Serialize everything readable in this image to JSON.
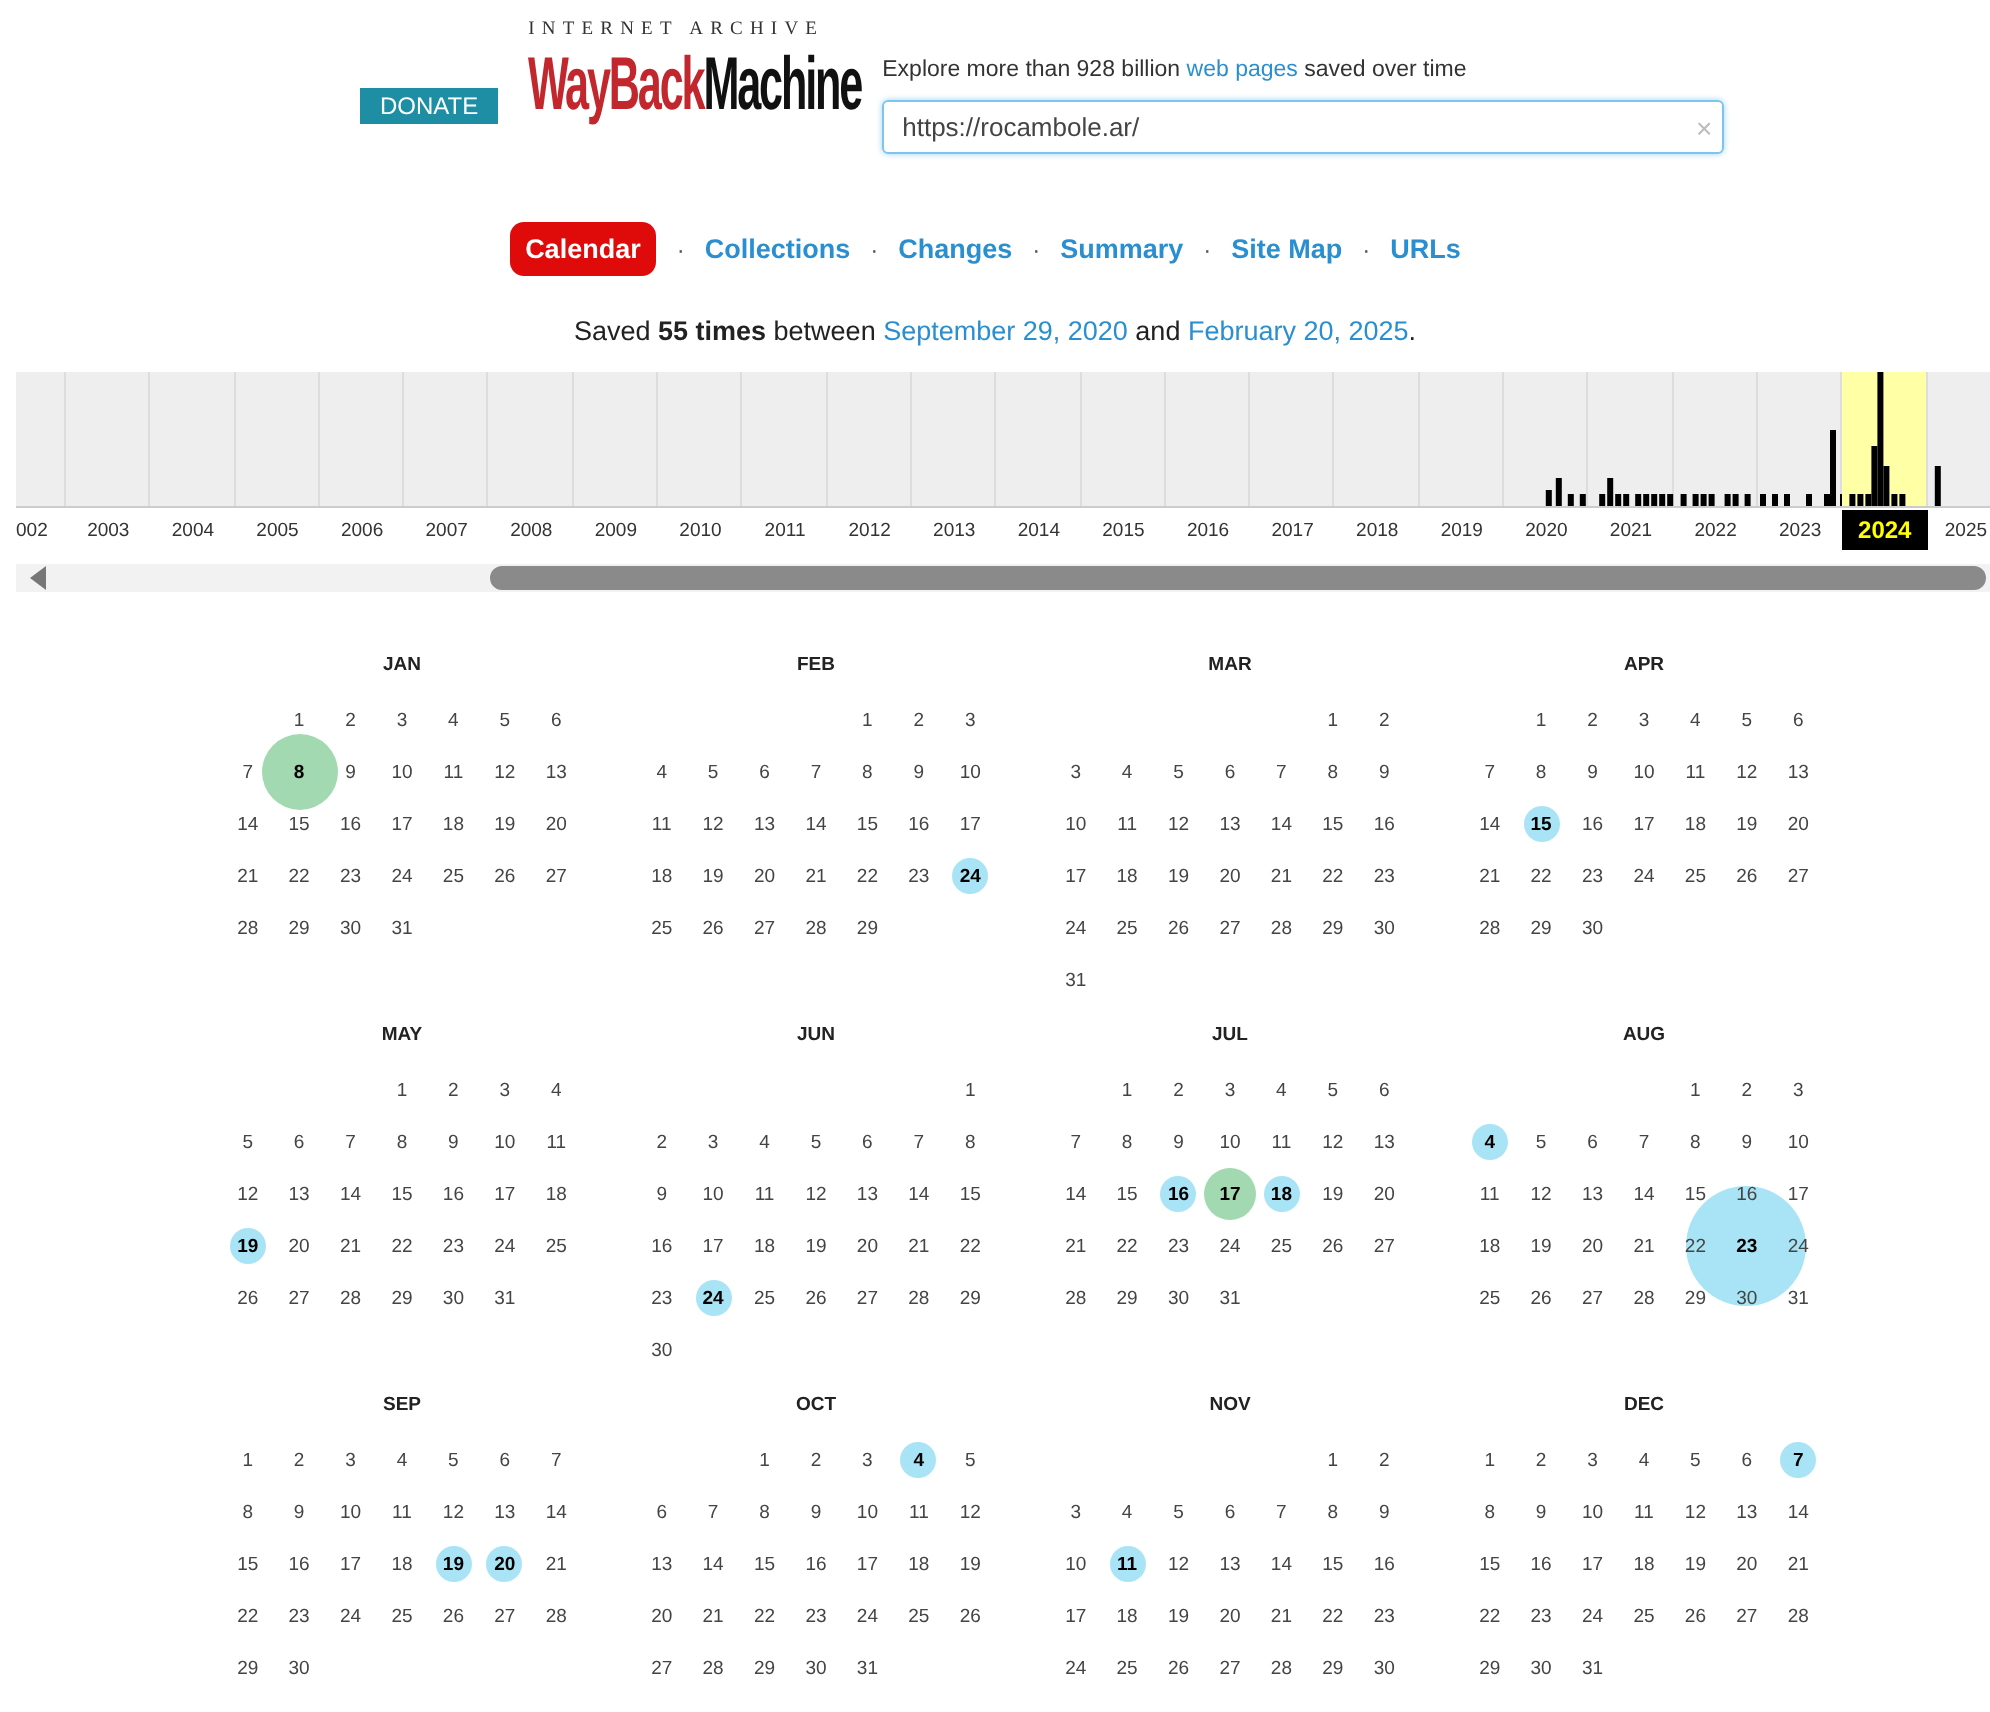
{
  "header": {
    "donate": "DONATE",
    "logo": {
      "top": "INTERNET ARCHIVE",
      "word_red": "WayBack",
      "word_black": "Machine"
    },
    "tagline": {
      "before": "Explore more than 928 billion ",
      "link": "web pages",
      "after": " saved over time"
    },
    "search": {
      "value": "https://rocambole.ar/",
      "clear": "×"
    }
  },
  "tabs": [
    {
      "label": "Calendar",
      "selected": true
    },
    {
      "label": "Collections",
      "selected": false
    },
    {
      "label": "Changes",
      "selected": false
    },
    {
      "label": "Summary",
      "selected": false
    },
    {
      "label": "Site Map",
      "selected": false
    },
    {
      "label": "URLs",
      "selected": false
    }
  ],
  "separator": "·",
  "summary": {
    "before": "Saved **55 times** between ",
    "first": "September 29, 2020",
    "middle": " and ",
    "last": "February 20, 2025",
    "after": "."
  },
  "timeline": {
    "years": [
      {
        "label": "002",
        "selected": false
      },
      {
        "label": "2003",
        "selected": false
      },
      {
        "label": "2004",
        "selected": false
      },
      {
        "label": "2005",
        "selected": false
      },
      {
        "label": "2006",
        "selected": false
      },
      {
        "label": "2007",
        "selected": false
      },
      {
        "label": "2008",
        "selected": false
      },
      {
        "label": "2009",
        "selected": false
      },
      {
        "label": "2010",
        "selected": false
      },
      {
        "label": "2011",
        "selected": false
      },
      {
        "label": "2012",
        "selected": false
      },
      {
        "label": "2013",
        "selected": false
      },
      {
        "label": "2014",
        "selected": false
      },
      {
        "label": "2015",
        "selected": false
      },
      {
        "label": "2016",
        "selected": false
      },
      {
        "label": "2017",
        "selected": false
      },
      {
        "label": "2018",
        "selected": false
      },
      {
        "label": "2019",
        "selected": false
      },
      {
        "label": "2020",
        "selected": false
      },
      {
        "label": "2021",
        "selected": false
      },
      {
        "label": "2022",
        "selected": false
      },
      {
        "label": "2023",
        "selected": false
      },
      {
        "label": "2024",
        "selected": true
      },
      {
        "label": "2025",
        "selected": false
      }
    ]
  },
  "calendar": {
    "months": [
      {
        "name": "JAN",
        "weeks": [
          [
            "1",
            "2",
            "3",
            "4",
            "5",
            "6"
          ],
          [
            "7",
            {
              "day": "8",
              "color": "#a3d9b1",
              "kind": "large"
            },
            "9",
            "10",
            "11",
            "12",
            "13"
          ],
          [
            "14",
            "15",
            "16",
            "17",
            "18",
            "19",
            "20"
          ],
          [
            "21",
            "22",
            "23",
            "24",
            "25",
            "26",
            "27"
          ],
          [
            "28",
            "29",
            "30",
            "31"
          ]
        ]
      },
      {
        "name": "FEB",
        "weeks": [
          [
            "1",
            "2",
            "3"
          ],
          [
            "4",
            "5",
            "6",
            "7",
            "8",
            "9",
            "10"
          ],
          [
            "11",
            "12",
            "13",
            "14",
            "15",
            "16",
            "17"
          ],
          [
            "18",
            "19",
            "20",
            "21",
            "22",
            "23",
            {
              "day": "24",
              "color": "#a8e4f6",
              "kind": "small"
            }
          ],
          [
            "25",
            "26",
            "27",
            "28",
            "29"
          ]
        ]
      },
      {
        "name": "MAR",
        "weeks": [
          [
            "1",
            "2"
          ],
          [
            "3",
            "4",
            "5",
            "6",
            "7",
            "8",
            "9"
          ],
          [
            "10",
            "11",
            "12",
            "13",
            "14",
            "15",
            "16"
          ],
          [
            "17",
            "18",
            "19",
            "20",
            "21",
            "22",
            "23"
          ],
          [
            "24",
            "25",
            "26",
            "27",
            "28",
            "29",
            "30"
          ],
          [
            "31"
          ]
        ]
      },
      {
        "name": "APR",
        "weeks": [
          [
            "1",
            "2",
            "3",
            "4",
            "5",
            "6"
          ],
          [
            "7",
            "8",
            "9",
            "10",
            "11",
            "12",
            "13"
          ],
          [
            "14",
            {
              "day": "15",
              "color": "#a8e4f6",
              "kind": "small"
            },
            "16",
            "17",
            "18",
            "19",
            "20"
          ],
          [
            "21",
            "22",
            "23",
            "24",
            "25",
            "26",
            "27"
          ],
          [
            "28",
            "29",
            "30"
          ]
        ]
      },
      {
        "name": "MAY",
        "weeks": [
          [
            "1",
            "2",
            "3",
            "4"
          ],
          [
            "5",
            "6",
            "7",
            "8",
            "9",
            "10",
            "11"
          ],
          [
            "12",
            "13",
            "14",
            "15",
            "16",
            "17",
            "18"
          ],
          [
            {
              "day": "19",
              "color": "#a8e4f6",
              "kind": "small"
            },
            "20",
            "21",
            "22",
            "23",
            "24",
            "25"
          ],
          [
            "26",
            "27",
            "28",
            "29",
            "30",
            "31"
          ]
        ]
      },
      {
        "name": "JUN",
        "weeks": [
          [
            "1"
          ],
          [
            "2",
            "3",
            "4",
            "5",
            "6",
            "7",
            "8"
          ],
          [
            "9",
            "10",
            "11",
            "12",
            "13",
            "14",
            "15"
          ],
          [
            "16",
            "17",
            "18",
            "19",
            "20",
            "21",
            "22"
          ],
          [
            "23",
            {
              "day": "24",
              "color": "#a8e4f6",
              "kind": "small"
            },
            "25",
            "26",
            "27",
            "28",
            "29"
          ],
          [
            "30"
          ]
        ]
      },
      {
        "name": "JUL",
        "weeks": [
          [
            "1",
            "2",
            "3",
            "4",
            "5",
            "6"
          ],
          [
            "7",
            "8",
            "9",
            "10",
            "11",
            "12",
            "13"
          ],
          [
            "14",
            "15",
            {
              "day": "16",
              "color": "#a8e4f6",
              "kind": "small"
            },
            {
              "day": "17",
              "color": "#a3d9b1",
              "kind": "medium"
            },
            {
              "day": "18",
              "color": "#a8e4f6",
              "kind": "small"
            },
            "19",
            "20"
          ],
          [
            "21",
            "22",
            "23",
            "24",
            "25",
            "26",
            "27"
          ],
          [
            "28",
            "29",
            "30",
            "31"
          ]
        ]
      },
      {
        "name": "AUG",
        "weeks": [
          [
            "1",
            "2",
            "3"
          ],
          [
            {
              "day": "4",
              "color": "#a8e4f6",
              "kind": "small"
            },
            "5",
            "6",
            "7",
            "8",
            "9",
            "10"
          ],
          [
            "11",
            "12",
            "13",
            "14",
            "15",
            "16",
            "17"
          ],
          [
            "18",
            "19",
            "20",
            "21",
            "22",
            {
              "day": "23",
              "color": "#a8e4f6",
              "kind": "huge"
            },
            "24"
          ],
          [
            "25",
            "26",
            "27",
            "28",
            "29",
            "30",
            "31"
          ]
        ]
      },
      {
        "name": "SEP",
        "weeks": [
          [
            "1",
            "2",
            "3",
            "4",
            "5",
            "6",
            "7"
          ],
          [
            "8",
            "9",
            "10",
            "11",
            "12",
            "13",
            "14"
          ],
          [
            "15",
            "16",
            "17",
            "18",
            {
              "day": "19",
              "color": "#a8e4f6",
              "kind": "small"
            },
            {
              "day": "20",
              "color": "#a8e4f6",
              "kind": "small"
            },
            "21"
          ],
          [
            "22",
            "23",
            "24",
            "25",
            "26",
            "27",
            "28"
          ],
          [
            "29",
            "30"
          ]
        ]
      },
      {
        "name": "OCT",
        "weeks": [
          [
            "1",
            "2",
            "3",
            {
              "day": "4",
              "color": "#a8e4f6",
              "kind": "small"
            },
            "5"
          ],
          [
            "6",
            "7",
            "8",
            "9",
            "10",
            "11",
            "12"
          ],
          [
            "13",
            "14",
            "15",
            "16",
            "17",
            "18",
            "19"
          ],
          [
            "20",
            "21",
            "22",
            "23",
            "24",
            "25",
            "26"
          ],
          [
            "27",
            "28",
            "29",
            "30",
            "31"
          ]
        ]
      },
      {
        "name": "NOV",
        "weeks": [
          [
            "1",
            "2"
          ],
          [
            "3",
            "4",
            "5",
            "6",
            "7",
            "8",
            "9"
          ],
          [
            "10",
            {
              "day": "11",
              "color": "#a8e4f6",
              "kind": "small"
            },
            "12",
            "13",
            "14",
            "15",
            "16"
          ],
          [
            "17",
            "18",
            "19",
            "20",
            "21",
            "22",
            "23"
          ],
          [
            "24",
            "25",
            "26",
            "27",
            "28",
            "29",
            "30"
          ]
        ]
      },
      {
        "name": "DEC",
        "weeks": [
          [
            "1",
            "2",
            "3",
            "4",
            "5",
            "6",
            {
              "day": "7",
              "color": "#a8e4f6",
              "kind": "small"
            }
          ],
          [
            "8",
            "9",
            "10",
            "11",
            "12",
            "13",
            "14"
          ],
          [
            "15",
            "16",
            "17",
            "18",
            "19",
            "20",
            "21"
          ],
          [
            "22",
            "23",
            "24",
            "25",
            "26",
            "27",
            "28"
          ],
          [
            "29",
            "30",
            "31"
          ]
        ]
      }
    ]
  }
}
